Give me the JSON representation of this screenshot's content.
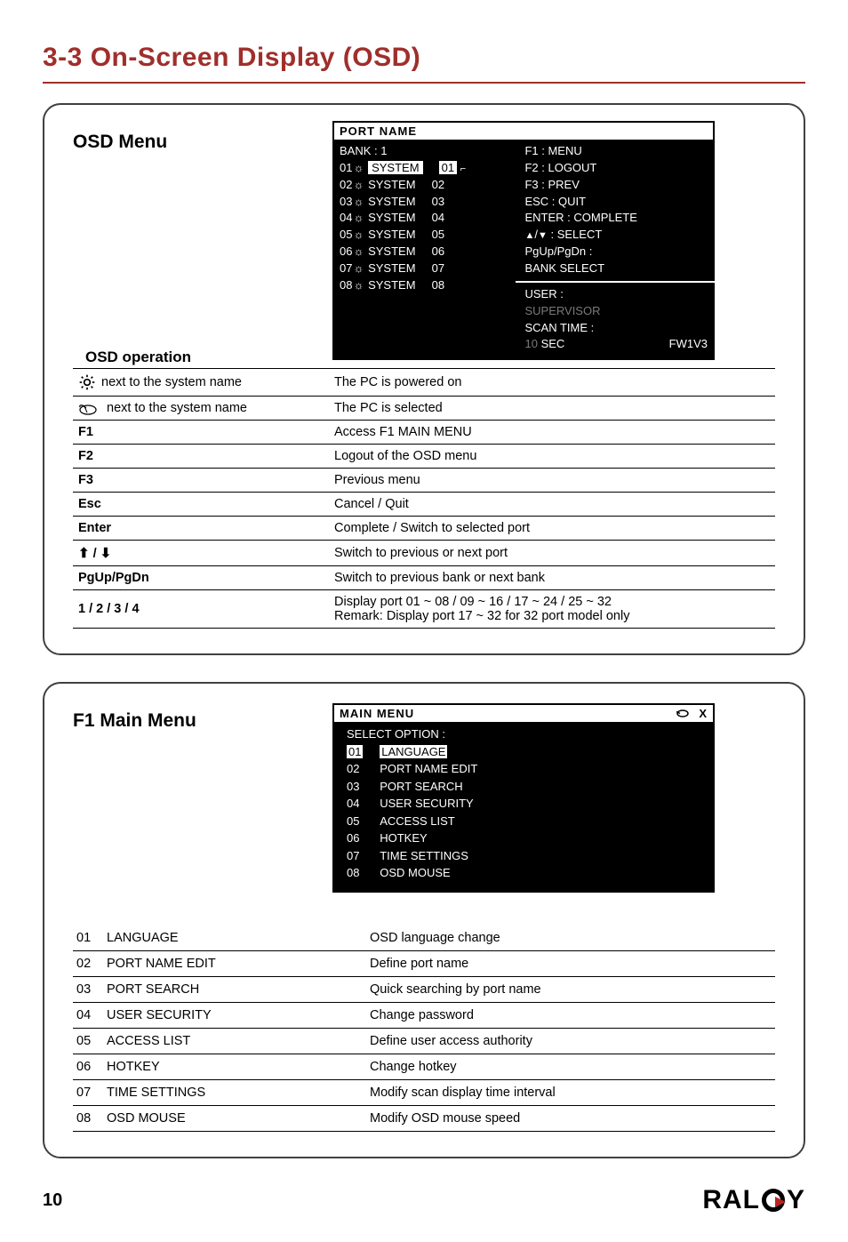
{
  "title": "3-3  On-Screen Display (OSD)",
  "panel1": {
    "heading": "OSD Menu",
    "osd": {
      "header": "PORT  NAME",
      "bank": "BANK : 1",
      "ports": [
        {
          "n": "01",
          "sun": "☼",
          "name": "SYSTEM",
          "r": "01",
          "sel": true,
          "mouse": true
        },
        {
          "n": "02",
          "sun": "☼",
          "name": "SYSTEM",
          "r": "02"
        },
        {
          "n": "03",
          "sun": "☼",
          "name": "SYSTEM",
          "r": "03"
        },
        {
          "n": "04",
          "sun": "☼",
          "name": "SYSTEM",
          "r": "04"
        },
        {
          "n": "05",
          "sun": "☼",
          "name": "SYSTEM",
          "r": "05"
        },
        {
          "n": "06",
          "sun": "☼",
          "name": "SYSTEM",
          "r": "06"
        },
        {
          "n": "07",
          "sun": "☼",
          "name": "SYSTEM",
          "r": "07"
        },
        {
          "n": "08",
          "sun": "☼",
          "name": "SYSTEM",
          "r": "08"
        }
      ],
      "help": [
        "F1 : MENU",
        "F2 : LOGOUT",
        "F3 : PREV",
        "ESC : QUIT",
        "ENTER : COMPLETE",
        "✦/✦ : SELECT",
        "PgUp/PgDn :",
        "BANK SELECT"
      ],
      "user_label": "USER :",
      "user_value": "SUPERVISOR",
      "scan_label": "SCAN TIME :",
      "scan_value": "10",
      "scan_unit": "SEC",
      "fw": "FW1V3"
    },
    "subheading": "OSD operation",
    "rows": [
      {
        "key_icon": "sun",
        "key_after": "next to the system name",
        "desc": "The PC is powered on"
      },
      {
        "key_icon": "mouse",
        "key_after": "next to the system name",
        "desc": "The PC is selected"
      },
      {
        "key": "F1",
        "desc": "Access F1 MAIN MENU"
      },
      {
        "key": "F2",
        "desc": "Logout of the OSD menu"
      },
      {
        "key": "F3",
        "desc": "Previous menu"
      },
      {
        "key": "Esc",
        "desc": "Cancel / Quit"
      },
      {
        "key": "Enter",
        "desc": "Complete / Switch to selected port"
      },
      {
        "key_icon": "arrows",
        "desc": "Switch to previous or next port"
      },
      {
        "key": "PgUp/PgDn",
        "desc": "Switch to previous bank or next bank"
      },
      {
        "key": "1 / 2 / 3 / 4",
        "desc": "Display port  01 ~ 08 / 09 ~ 16 / 17 ~ 24 / 25 ~ 32",
        "desc2": "Remark:  Display port 17 ~ 32 for 32 port model only"
      }
    ]
  },
  "panel2": {
    "heading": "F1 Main Menu",
    "mm": {
      "header": "MAIN  MENU",
      "select": "SELECT OPTION :",
      "items": [
        {
          "n": "01",
          "label": "LANGUAGE",
          "sel": true
        },
        {
          "n": "02",
          "label": "PORT NAME  EDIT"
        },
        {
          "n": "03",
          "label": "PORT SEARCH"
        },
        {
          "n": "04",
          "label": "USER SECURITY"
        },
        {
          "n": "05",
          "label": "ACCESS LIST"
        },
        {
          "n": "06",
          "label": "HOTKEY"
        },
        {
          "n": "07",
          "label": "TIME SETTINGS"
        },
        {
          "n": "08",
          "label": "OSD MOUSE"
        }
      ]
    },
    "rows": [
      {
        "n": "01",
        "label": "LANGUAGE",
        "desc": "OSD language change"
      },
      {
        "n": "02",
        "label": "PORT NAME EDIT",
        "desc": "Define port name"
      },
      {
        "n": "03",
        "label": "PORT SEARCH",
        "desc": "Quick searching by port name"
      },
      {
        "n": "04",
        "label": "USER SECURITY",
        "desc": "Change password"
      },
      {
        "n": "05",
        "label": "ACCESS LIST",
        "desc": "Define user access authority"
      },
      {
        "n": "06",
        "label": "HOTKEY",
        "desc": "Change hotkey"
      },
      {
        "n": "07",
        "label": "TIME SETTINGS",
        "desc": "Modify scan display time interval"
      },
      {
        "n": "08",
        "label": "OSD MOUSE",
        "desc": "Modify OSD mouse speed"
      }
    ]
  },
  "page_number": "10",
  "brand": "RALOY"
}
